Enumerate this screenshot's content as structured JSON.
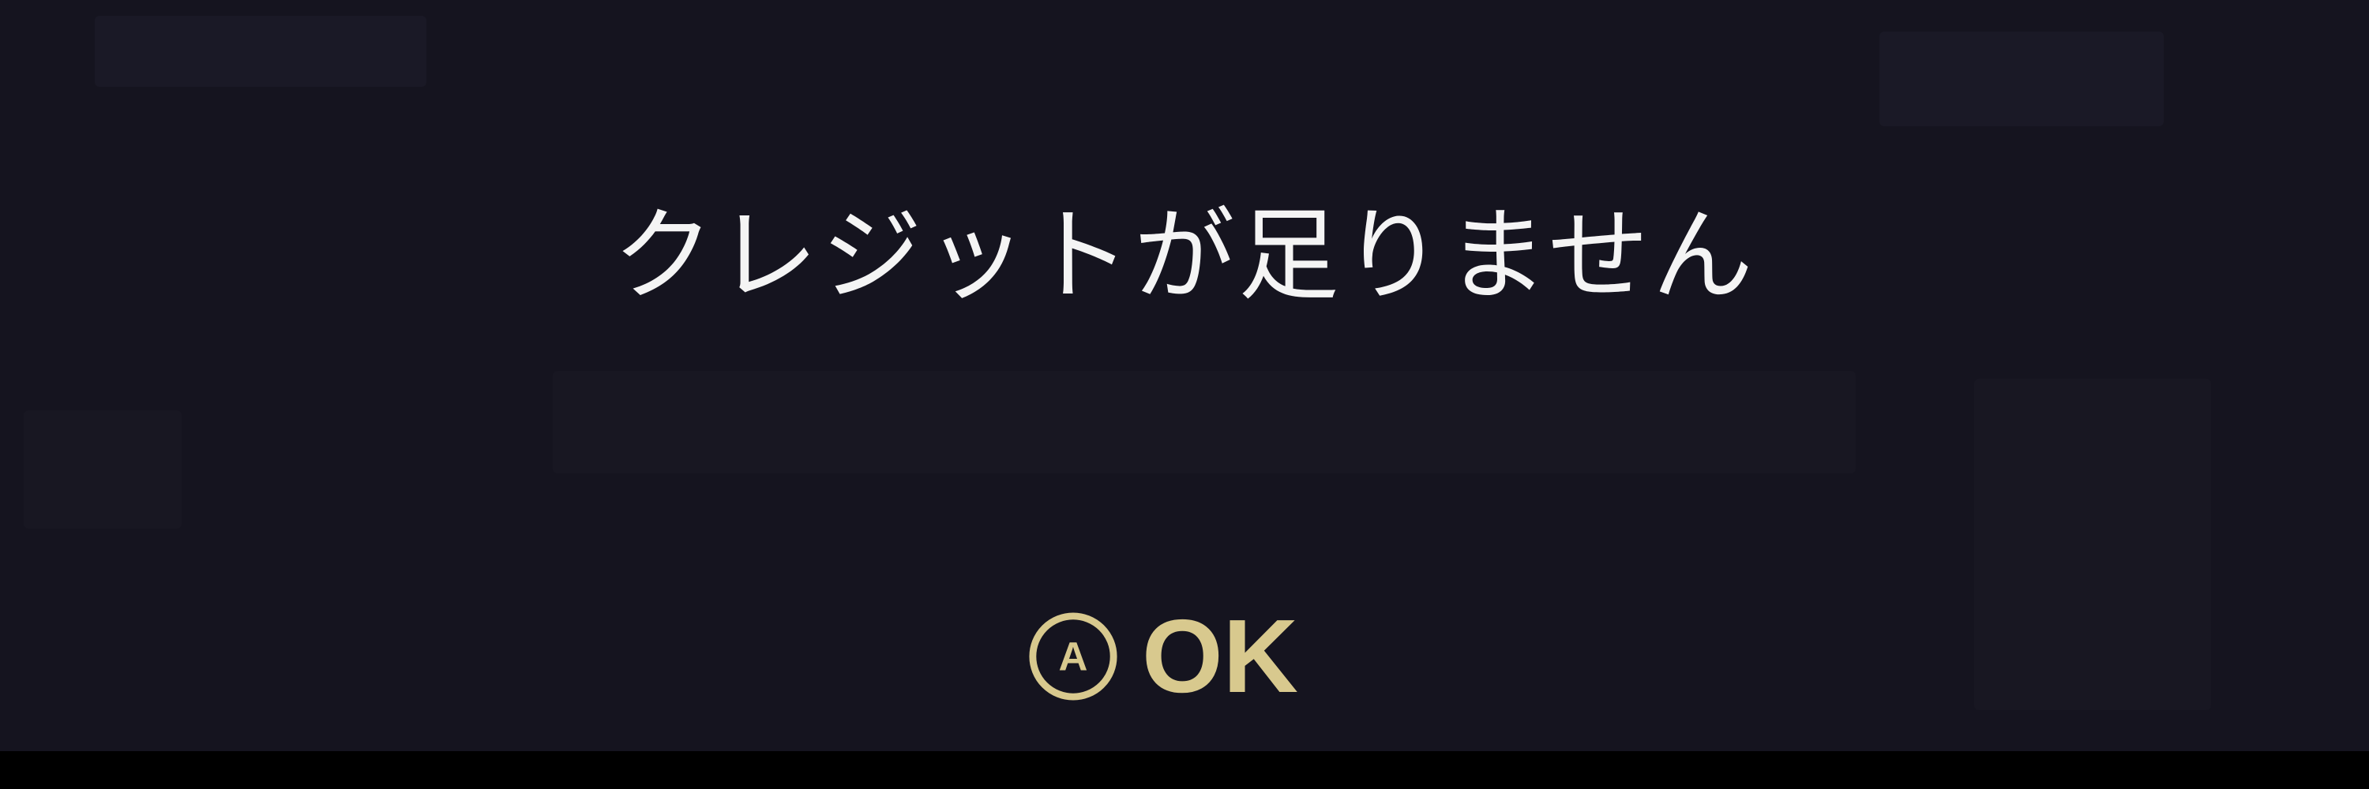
{
  "dialog": {
    "message": "クレジットが足りません",
    "confirm": {
      "button_glyph": "A",
      "label": "OK",
      "icon": "a-button-icon"
    }
  },
  "colors": {
    "background": "#15141f",
    "message_text": "#f4f4f4",
    "accent_gold": "#d8c98e",
    "letterbox": "#000000"
  }
}
